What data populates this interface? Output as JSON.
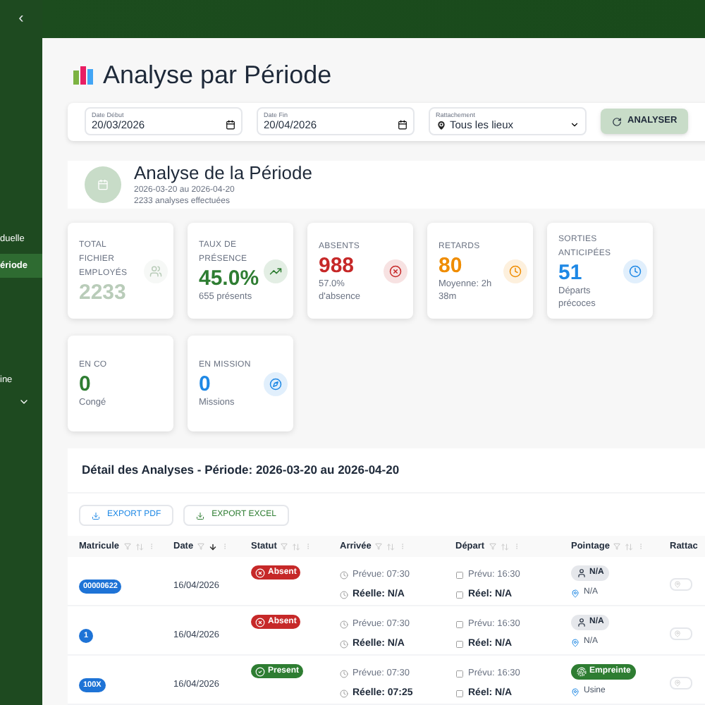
{
  "sidebar": {
    "collapse": "‹",
    "items": [
      {
        "label": "duelle",
        "selected": false
      },
      {
        "label": "ériode",
        "selected": true
      },
      {
        "label": "ine",
        "selected": false
      }
    ]
  },
  "page": {
    "title": "Analyse par Période"
  },
  "filters": {
    "fields": [
      {
        "label": "Date Début",
        "value": "20/03/2026",
        "kind": "date"
      },
      {
        "label": "Date Fin",
        "value": "20/04/2026",
        "kind": "date"
      },
      {
        "label": "Rattachement",
        "value": "Tous les lieux",
        "kind": "select"
      }
    ],
    "button": "ANALYSER"
  },
  "summary": {
    "title": "Analyse de la Période",
    "range": "2026-03-20 au 2026-04-20",
    "count": "2233 analyses effectuées"
  },
  "stats": [
    {
      "label": [
        "TOTAL",
        "FICHIER",
        "EMPLOYÉS"
      ],
      "value": "2233",
      "color": "#b9ccb9"
    },
    {
      "label": [
        "TAUX DE",
        "PRÉSENCE"
      ],
      "value": "45.0%",
      "sub": "655 présents",
      "color": "#2e7d32"
    },
    {
      "label": [
        "ABSENTS"
      ],
      "value": "988",
      "sub": "57.0% d'absence",
      "color": "#c62828"
    },
    {
      "label": [
        "RETARDS"
      ],
      "value": "80",
      "sub": "Moyenne: 2h 38m",
      "color": "#ef8c00"
    },
    {
      "label": [
        "SORTIES",
        "ANTICIPÉES"
      ],
      "value": "51",
      "sub": "Départs précoces",
      "color": "#1e88e5"
    },
    {
      "label": [
        "EN CO"
      ],
      "value": "0",
      "sub": "Congé",
      "color": "#2e7d32"
    },
    {
      "label": [
        "EN MISSION"
      ],
      "value": "0",
      "sub": "Missions",
      "color": "#1e88e5"
    }
  ],
  "table": {
    "title": "Détail des Analyses - Période: 2026-03-20 au 2026-04-20",
    "exports": [
      {
        "label": "EXPORT PDF",
        "kind": "pdf"
      },
      {
        "label": "EXPORT EXCEL",
        "kind": "excel"
      }
    ],
    "columns": [
      {
        "label": "Matricule",
        "sorted": false
      },
      {
        "label": "Date",
        "sorted": true
      },
      {
        "label": "Statut",
        "sorted": false
      },
      {
        "label": "Arrivée",
        "sorted": false
      },
      {
        "label": "Départ",
        "sorted": false
      },
      {
        "label": "Pointage",
        "sorted": false
      },
      {
        "label": "Rattac"
      }
    ],
    "rows": [
      {
        "matricule": "00000622",
        "date": "16/04/2026",
        "status": {
          "kind": "absent",
          "label": "Absent"
        },
        "arrival": [
          "Prévue: 07:30",
          "Réelle: N/A"
        ],
        "departure": [
          "Prévu: 16:30",
          "Réel: N/A"
        ],
        "pointage": {
          "kind": "none",
          "label": "N/A",
          "place": "N/A"
        }
      },
      {
        "matricule": "1",
        "date": "16/04/2026",
        "status": {
          "kind": "absent",
          "label": "Absent"
        },
        "arrival": [
          "Prévue: 07:30",
          "Réelle: N/A"
        ],
        "departure": [
          "Prévu: 16:30",
          "Réel: N/A"
        ],
        "pointage": {
          "kind": "none",
          "label": "N/A",
          "place": "N/A"
        }
      },
      {
        "matricule": "100X",
        "date": "16/04/2026",
        "status": {
          "kind": "present",
          "label": "Present"
        },
        "arrival": [
          "Prévue: 07:30",
          "Réelle: 07:25"
        ],
        "departure": [
          "Prévu: 16:30",
          "Réel: N/A"
        ],
        "pointage": {
          "kind": "fingerprint",
          "label": "Empreinte",
          "place": "Usine"
        }
      }
    ]
  }
}
